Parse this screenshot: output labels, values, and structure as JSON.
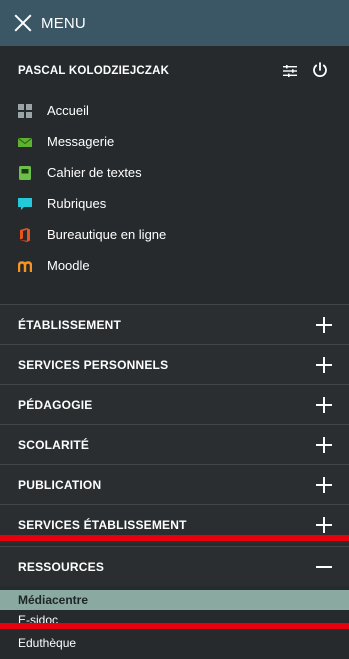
{
  "header": {
    "menu_label": "MENU"
  },
  "user": {
    "name": "PASCAL KOLODZIEJCZAK"
  },
  "apps": [
    {
      "label": "Accueil",
      "icon": "grid-icon",
      "color": "#9aa3a8"
    },
    {
      "label": "Messagerie",
      "icon": "envelope-icon",
      "color": "#5fb230"
    },
    {
      "label": "Cahier de textes",
      "icon": "notebook-icon",
      "color": "#6cc04a"
    },
    {
      "label": "Rubriques",
      "icon": "chat-icon",
      "color": "#23c9d8"
    },
    {
      "label": "Bureautique en ligne",
      "icon": "office-icon",
      "color": "#e8531e"
    },
    {
      "label": "Moodle",
      "icon": "moodle-icon",
      "color": "#f7931e"
    }
  ],
  "sections": [
    {
      "label": "ÉTABLISSEMENT",
      "state": "collapsed"
    },
    {
      "label": "SERVICES PERSONNELS",
      "state": "collapsed"
    },
    {
      "label": "PÉDAGOGIE",
      "state": "collapsed"
    },
    {
      "label": "SCOLARITÉ",
      "state": "collapsed"
    },
    {
      "label": "PUBLICATION",
      "state": "collapsed"
    },
    {
      "label": "SERVICES ÉTABLISSEMENT",
      "state": "collapsed"
    },
    {
      "label": "RESSOURCES",
      "state": "expanded"
    }
  ],
  "ressources_items": [
    {
      "label": "Médiacentre",
      "active": true
    },
    {
      "label": "E-sidoc",
      "active": false
    },
    {
      "label": "Eduthèque",
      "active": false
    }
  ],
  "colors": {
    "header_bg": "#3b5766",
    "panel_bg": "#262a2d",
    "active_item_bg": "#8aa9a0",
    "highlight": "#e8000c"
  }
}
